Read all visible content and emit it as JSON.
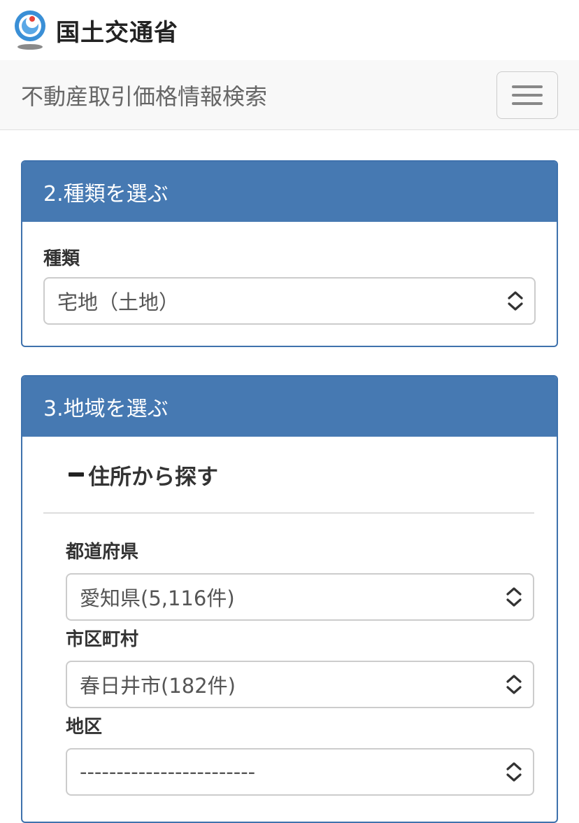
{
  "header": {
    "ministry_name": "国土交通省"
  },
  "navbar": {
    "brand": "不動産取引価格情報検索"
  },
  "panel_type": {
    "heading": "2.種類を選ぶ",
    "type_label": "種類",
    "type_value": "宅地（土地）"
  },
  "panel_region": {
    "heading": "3.地域を選ぶ",
    "section_title": "住所から探す",
    "prefecture_label": "都道府県",
    "prefecture_value": "愛知県(5,116件)",
    "city_label": "市区町村",
    "city_value": "春日井市(182件)",
    "district_label": "地区",
    "district_value": "------------------------"
  },
  "colors": {
    "panel_heading": "#4679b2",
    "panel_border": "#3f72ad",
    "navbar_bg": "#f8f8f8"
  },
  "icons": [
    "mlit-logo",
    "hamburger-menu-icon",
    "select-chevron-icon"
  ]
}
